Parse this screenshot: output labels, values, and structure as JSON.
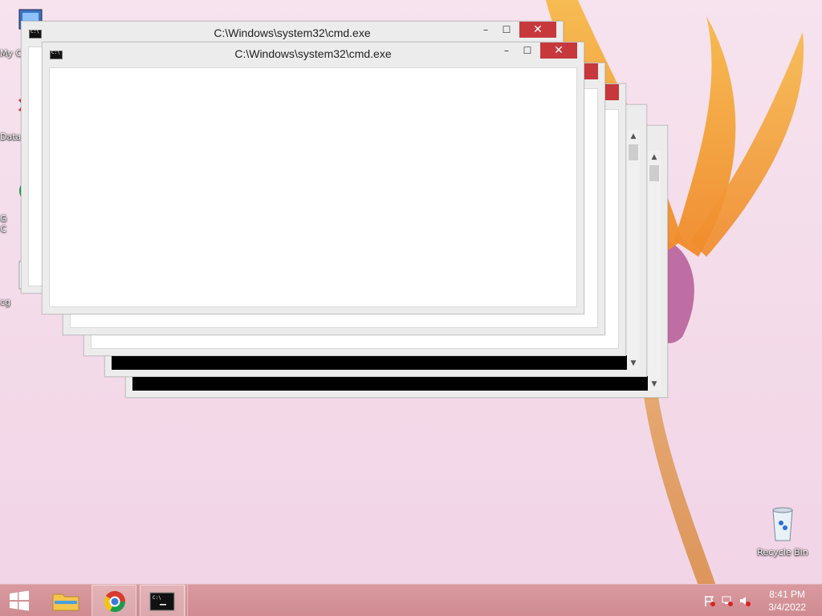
{
  "desktop": {
    "icons": [
      {
        "name": "my-computer",
        "label": "My C"
      },
      {
        "name": "data",
        "label": "Data"
      },
      {
        "name": "google-chrome",
        "label": "G\nC"
      },
      {
        "name": "file-cg",
        "label": "cg"
      }
    ],
    "recycle_bin": {
      "label": "Recycle Bin"
    }
  },
  "windows": [
    {
      "title": "C:\\Windows\\system32\\cmd.exe"
    },
    {
      "title": "C:\\Windows\\system32\\cmd.exe"
    },
    {
      "title": ""
    },
    {
      "title": ""
    },
    {
      "title": ""
    },
    {
      "title": ""
    }
  ],
  "window_controls": {
    "minimize": "–",
    "maximize": "☐",
    "close": "✕"
  },
  "taskbar": {
    "start_icon": "windows-logo-icon",
    "pinned": [
      "file-explorer-icon",
      "chrome-icon",
      "cmd-icon"
    ],
    "tray_icons": [
      "flag-icon",
      "network-icon",
      "volume-muted-icon"
    ],
    "time": "8:41 PM",
    "date": "3/4/2022"
  },
  "colors": {
    "close_button": "#c7383d",
    "taskbar": "#d4949a"
  }
}
